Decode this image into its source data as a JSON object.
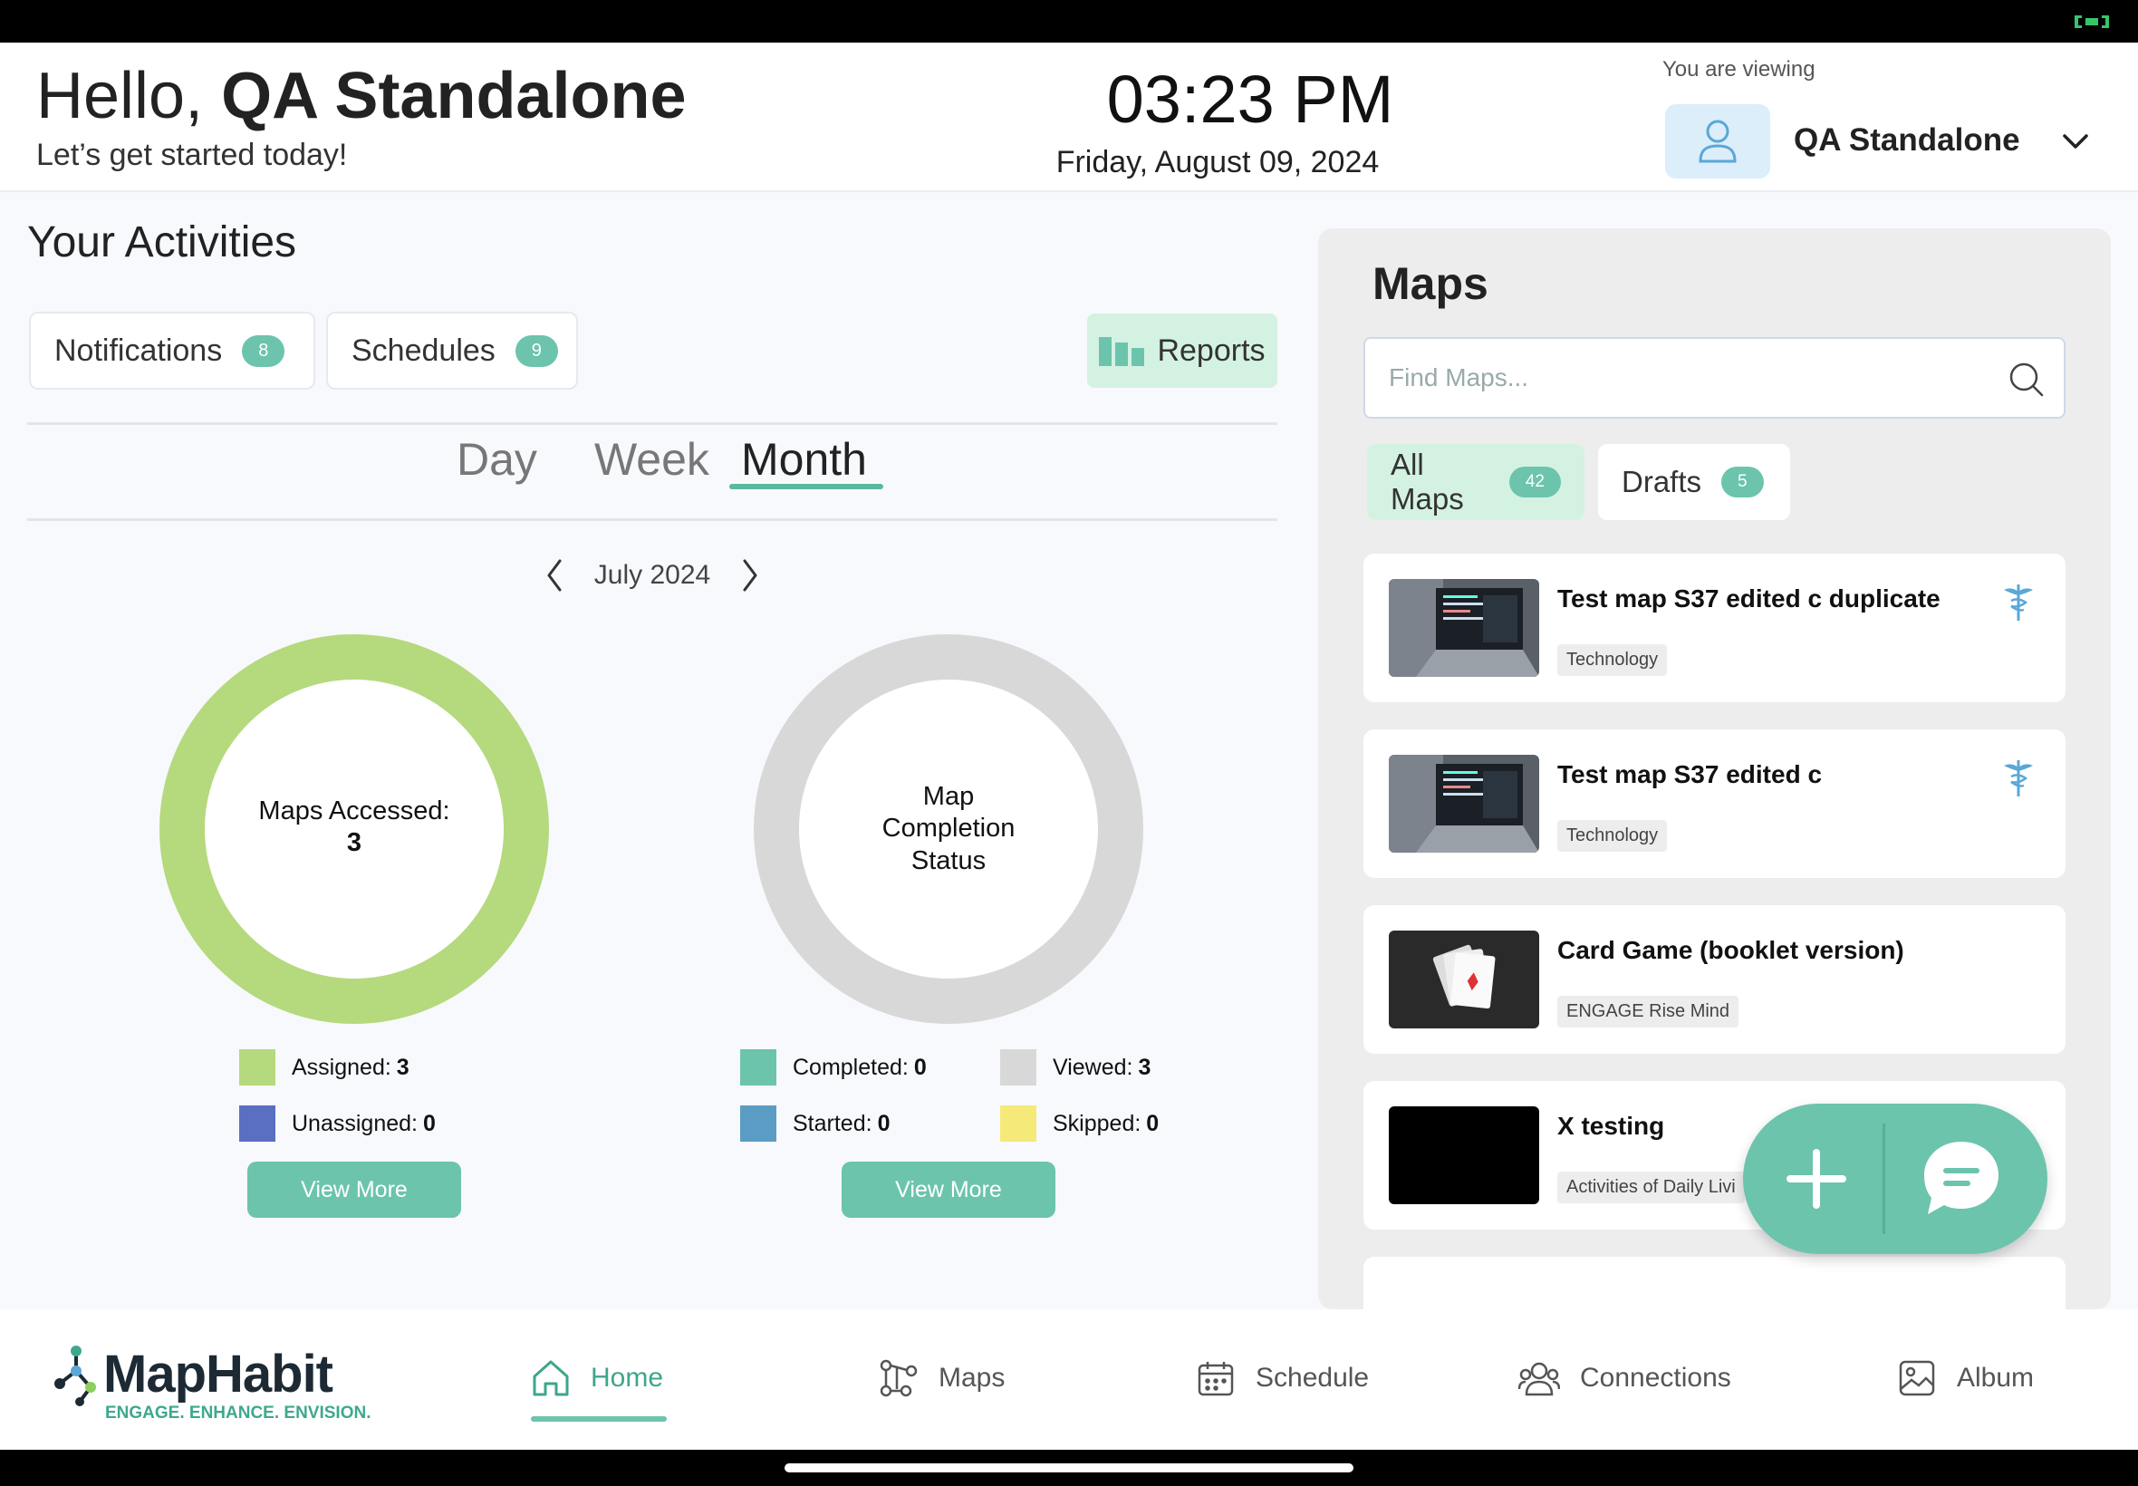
{
  "header": {
    "greeting_prefix": "Hello, ",
    "user_name": "QA Standalone",
    "subtitle": "Let’s get started today!",
    "time": "03:23 PM",
    "date": "Friday, August 09, 2024",
    "viewing_label": "You are viewing",
    "viewing_name": "QA Standalone"
  },
  "activities": {
    "title": "Your Activities",
    "notifications": {
      "label": "Notifications",
      "count": "8"
    },
    "schedules": {
      "label": "Schedules",
      "count": "9"
    },
    "reports_label": "Reports",
    "tabs": [
      "Day",
      "Week",
      "Month"
    ],
    "active_tab": "Month",
    "month_label": "July 2024",
    "accessed": {
      "label": "Maps Accessed:",
      "value": "3",
      "legend": [
        {
          "label": "Assigned:",
          "value": "3",
          "color": "#b5d97d"
        },
        {
          "label": "Unassigned:",
          "value": "0",
          "color": "#5a6fc2"
        }
      ],
      "view_more": "View More"
    },
    "completion": {
      "label_lines": [
        "Map",
        "Completion",
        "Status"
      ],
      "legend": [
        {
          "label": "Completed:",
          "value": "0",
          "color": "#6cc4ad"
        },
        {
          "label": "Viewed:",
          "value": "3",
          "color": "#d8d8d8"
        },
        {
          "label": "Started:",
          "value": "0",
          "color": "#5a9cc4"
        },
        {
          "label": "Skipped:",
          "value": "0",
          "color": "#f5e97a"
        }
      ],
      "view_more": "View More"
    }
  },
  "maps": {
    "title": "Maps",
    "search_placeholder": "Find Maps...",
    "tabs": [
      {
        "label": "All Maps",
        "count": "42"
      },
      {
        "label": "Drafts",
        "count": "5"
      }
    ],
    "cards": [
      {
        "title": "Test map S37 edited c duplicate",
        "tag": "Technology",
        "icon": "caduceus-icon"
      },
      {
        "title": "Test map S37 edited c",
        "tag": "Technology",
        "icon": "caduceus-icon"
      },
      {
        "title": "Card Game (booklet version)",
        "tag": "ENGAGE Rise Mind",
        "icon": ""
      },
      {
        "title": "X testing",
        "tag": "Activities of Daily Livi",
        "icon": ""
      }
    ]
  },
  "nav": {
    "brand": "MapHabit",
    "tagline": "ENGAGE. ENHANCE. ENVISION.",
    "items": [
      "Home",
      "Maps",
      "Schedule",
      "Connections",
      "Album"
    ],
    "active": "Home"
  },
  "colors": {
    "accent": "#6cc4ad",
    "accent_light": "#d4f2e2",
    "assigned": "#b5d97d",
    "viewed": "#d8d8d8"
  }
}
